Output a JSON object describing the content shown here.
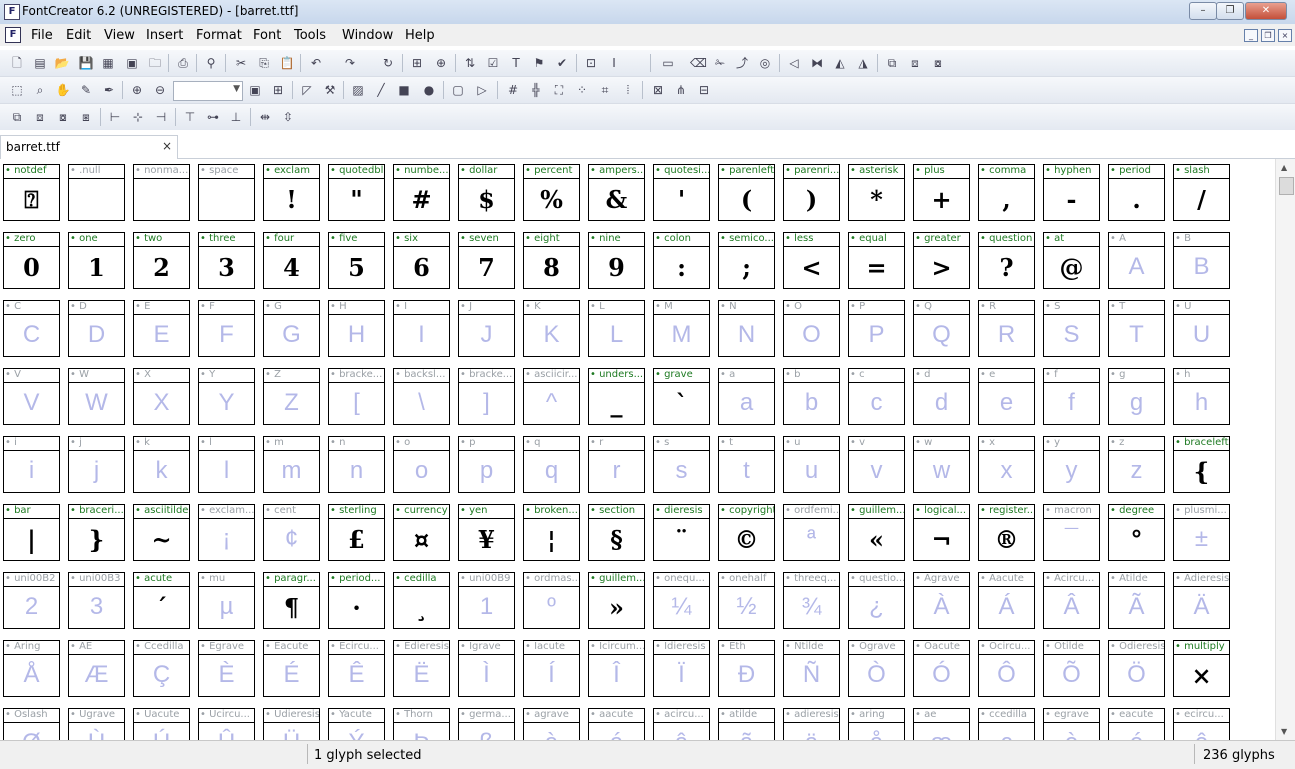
{
  "window": {
    "title": "FontCreator 6.2 (UNREGISTERED) - [barret.ttf]"
  },
  "menu": [
    "File",
    "Edit",
    "View",
    "Insert",
    "Format",
    "Font",
    "Tools",
    "Window",
    "Help"
  ],
  "toolbar": {
    "zoom_value": ""
  },
  "tab": {
    "label": "barret.ttf",
    "close": "×"
  },
  "status": {
    "selection": "1 glyph selected",
    "count": "236 glyphs"
  },
  "glyphs": [
    {
      "name": "notdef",
      "char": "⍰",
      "defined": true
    },
    {
      "name": ".null",
      "char": "",
      "defined": false
    },
    {
      "name": "nonma...",
      "char": "",
      "defined": false
    },
    {
      "name": "space",
      "char": "",
      "defined": false
    },
    {
      "name": "exclam",
      "char": "!",
      "defined": true
    },
    {
      "name": "quotedbl",
      "char": "\"",
      "defined": true
    },
    {
      "name": "numbe...",
      "char": "#",
      "defined": true
    },
    {
      "name": "dollar",
      "char": "$",
      "defined": true
    },
    {
      "name": "percent",
      "char": "%",
      "defined": true
    },
    {
      "name": "ampers...",
      "char": "&",
      "defined": true
    },
    {
      "name": "quotesi...",
      "char": "'",
      "defined": true
    },
    {
      "name": "parenleft",
      "char": "(",
      "defined": true
    },
    {
      "name": "parenri...",
      "char": ")",
      "defined": true
    },
    {
      "name": "asterisk",
      "char": "*",
      "defined": true
    },
    {
      "name": "plus",
      "char": "+",
      "defined": true
    },
    {
      "name": "comma",
      "char": ",",
      "defined": true
    },
    {
      "name": "hyphen",
      "char": "-",
      "defined": true
    },
    {
      "name": "period",
      "char": ".",
      "defined": true
    },
    {
      "name": "slash",
      "char": "/",
      "defined": true
    },
    {
      "name": "zero",
      "char": "0",
      "defined": true
    },
    {
      "name": "one",
      "char": "1",
      "defined": true
    },
    {
      "name": "two",
      "char": "2",
      "defined": true
    },
    {
      "name": "three",
      "char": "3",
      "defined": true
    },
    {
      "name": "four",
      "char": "4",
      "defined": true
    },
    {
      "name": "five",
      "char": "5",
      "defined": true
    },
    {
      "name": "six",
      "char": "6",
      "defined": true
    },
    {
      "name": "seven",
      "char": "7",
      "defined": true
    },
    {
      "name": "eight",
      "char": "8",
      "defined": true
    },
    {
      "name": "nine",
      "char": "9",
      "defined": true
    },
    {
      "name": "colon",
      "char": ":",
      "defined": true
    },
    {
      "name": "semico...",
      "char": ";",
      "defined": true
    },
    {
      "name": "less",
      "char": "<",
      "defined": true
    },
    {
      "name": "equal",
      "char": "=",
      "defined": true
    },
    {
      "name": "greater",
      "char": ">",
      "defined": true
    },
    {
      "name": "question",
      "char": "?",
      "defined": true
    },
    {
      "name": "at",
      "char": "@",
      "defined": true
    },
    {
      "name": "A",
      "char": "A",
      "defined": false
    },
    {
      "name": "B",
      "char": "B",
      "defined": false
    },
    {
      "name": "C",
      "char": "C",
      "defined": false
    },
    {
      "name": "D",
      "char": "D",
      "defined": false
    },
    {
      "name": "E",
      "char": "E",
      "defined": false
    },
    {
      "name": "F",
      "char": "F",
      "defined": false
    },
    {
      "name": "G",
      "char": "G",
      "defined": false
    },
    {
      "name": "H",
      "char": "H",
      "defined": false
    },
    {
      "name": "I",
      "char": "I",
      "defined": false
    },
    {
      "name": "J",
      "char": "J",
      "defined": false
    },
    {
      "name": "K",
      "char": "K",
      "defined": false
    },
    {
      "name": "L",
      "char": "L",
      "defined": false
    },
    {
      "name": "M",
      "char": "M",
      "defined": false
    },
    {
      "name": "N",
      "char": "N",
      "defined": false
    },
    {
      "name": "O",
      "char": "O",
      "defined": false
    },
    {
      "name": "P",
      "char": "P",
      "defined": false
    },
    {
      "name": "Q",
      "char": "Q",
      "defined": false
    },
    {
      "name": "R",
      "char": "R",
      "defined": false
    },
    {
      "name": "S",
      "char": "S",
      "defined": false
    },
    {
      "name": "T",
      "char": "T",
      "defined": false
    },
    {
      "name": "U",
      "char": "U",
      "defined": false
    },
    {
      "name": "V",
      "char": "V",
      "defined": false
    },
    {
      "name": "W",
      "char": "W",
      "defined": false
    },
    {
      "name": "X",
      "char": "X",
      "defined": false
    },
    {
      "name": "Y",
      "char": "Y",
      "defined": false
    },
    {
      "name": "Z",
      "char": "Z",
      "defined": false
    },
    {
      "name": "bracke...",
      "char": "[",
      "defined": false
    },
    {
      "name": "backsl...",
      "char": "\\",
      "defined": false
    },
    {
      "name": "bracke...",
      "char": "]",
      "defined": false
    },
    {
      "name": "asciicir...",
      "char": "^",
      "defined": false
    },
    {
      "name": "unders...",
      "char": "_",
      "defined": true
    },
    {
      "name": "grave",
      "char": "`",
      "defined": true
    },
    {
      "name": "a",
      "char": "a",
      "defined": false
    },
    {
      "name": "b",
      "char": "b",
      "defined": false
    },
    {
      "name": "c",
      "char": "c",
      "defined": false
    },
    {
      "name": "d",
      "char": "d",
      "defined": false
    },
    {
      "name": "e",
      "char": "e",
      "defined": false
    },
    {
      "name": "f",
      "char": "f",
      "defined": false
    },
    {
      "name": "g",
      "char": "g",
      "defined": false
    },
    {
      "name": "h",
      "char": "h",
      "defined": false
    },
    {
      "name": "i",
      "char": "i",
      "defined": false
    },
    {
      "name": "j",
      "char": "j",
      "defined": false
    },
    {
      "name": "k",
      "char": "k",
      "defined": false
    },
    {
      "name": "l",
      "char": "l",
      "defined": false
    },
    {
      "name": "m",
      "char": "m",
      "defined": false
    },
    {
      "name": "n",
      "char": "n",
      "defined": false
    },
    {
      "name": "o",
      "char": "o",
      "defined": false
    },
    {
      "name": "p",
      "char": "p",
      "defined": false
    },
    {
      "name": "q",
      "char": "q",
      "defined": false
    },
    {
      "name": "r",
      "char": "r",
      "defined": false
    },
    {
      "name": "s",
      "char": "s",
      "defined": false
    },
    {
      "name": "t",
      "char": "t",
      "defined": false
    },
    {
      "name": "u",
      "char": "u",
      "defined": false
    },
    {
      "name": "v",
      "char": "v",
      "defined": false
    },
    {
      "name": "w",
      "char": "w",
      "defined": false
    },
    {
      "name": "x",
      "char": "x",
      "defined": false
    },
    {
      "name": "y",
      "char": "y",
      "defined": false
    },
    {
      "name": "z",
      "char": "z",
      "defined": false
    },
    {
      "name": "braceleft",
      "char": "{",
      "defined": true
    },
    {
      "name": "bar",
      "char": "|",
      "defined": true
    },
    {
      "name": "braceri...",
      "char": "}",
      "defined": true
    },
    {
      "name": "asciitilde",
      "char": "~",
      "defined": true
    },
    {
      "name": "exclam...",
      "char": "¡",
      "defined": false
    },
    {
      "name": "cent",
      "char": "¢",
      "defined": false
    },
    {
      "name": "sterling",
      "char": "£",
      "defined": true
    },
    {
      "name": "currency",
      "char": "¤",
      "defined": true
    },
    {
      "name": "yen",
      "char": "¥",
      "defined": true
    },
    {
      "name": "broken...",
      "char": "¦",
      "defined": true
    },
    {
      "name": "section",
      "char": "§",
      "defined": true
    },
    {
      "name": "dieresis",
      "char": "¨",
      "defined": true
    },
    {
      "name": "copyright",
      "char": "©",
      "defined": true
    },
    {
      "name": "ordfemi...",
      "char": "ª",
      "defined": false
    },
    {
      "name": "guillem...",
      "char": "«",
      "defined": true
    },
    {
      "name": "logical...",
      "char": "¬",
      "defined": true
    },
    {
      "name": "register...",
      "char": "®",
      "defined": true
    },
    {
      "name": "macron",
      "char": "¯",
      "defined": false
    },
    {
      "name": "degree",
      "char": "°",
      "defined": true
    },
    {
      "name": "plusmi...",
      "char": "±",
      "defined": false
    },
    {
      "name": "uni00B2",
      "char": "2",
      "defined": false
    },
    {
      "name": "uni00B3",
      "char": "3",
      "defined": false
    },
    {
      "name": "acute",
      "char": "´",
      "defined": true
    },
    {
      "name": "mu",
      "char": "µ",
      "defined": false
    },
    {
      "name": "paragr...",
      "char": "¶",
      "defined": true
    },
    {
      "name": "period...",
      "char": "·",
      "defined": true
    },
    {
      "name": "cedilla",
      "char": "¸",
      "defined": true
    },
    {
      "name": "uni00B9",
      "char": "1",
      "defined": false
    },
    {
      "name": "ordmas...",
      "char": "º",
      "defined": false
    },
    {
      "name": "guillem...",
      "char": "»",
      "defined": true
    },
    {
      "name": "onequ...",
      "char": "¼",
      "defined": false
    },
    {
      "name": "onehalf",
      "char": "½",
      "defined": false
    },
    {
      "name": "threeq...",
      "char": "¾",
      "defined": false
    },
    {
      "name": "questio...",
      "char": "¿",
      "defined": false
    },
    {
      "name": "Agrave",
      "char": "À",
      "defined": false
    },
    {
      "name": "Aacute",
      "char": "Á",
      "defined": false
    },
    {
      "name": "Acircu...",
      "char": "Â",
      "defined": false
    },
    {
      "name": "Atilde",
      "char": "Ã",
      "defined": false
    },
    {
      "name": "Adieresis",
      "char": "Ä",
      "defined": false
    },
    {
      "name": "Aring",
      "char": "Å",
      "defined": false
    },
    {
      "name": "AE",
      "char": "Æ",
      "defined": false
    },
    {
      "name": "Ccedilla",
      "char": "Ç",
      "defined": false
    },
    {
      "name": "Egrave",
      "char": "È",
      "defined": false
    },
    {
      "name": "Eacute",
      "char": "É",
      "defined": false
    },
    {
      "name": "Ecircu...",
      "char": "Ê",
      "defined": false
    },
    {
      "name": "Edieresis",
      "char": "Ë",
      "defined": false
    },
    {
      "name": "Igrave",
      "char": "Ì",
      "defined": false
    },
    {
      "name": "Iacute",
      "char": "Í",
      "defined": false
    },
    {
      "name": "Icircum...",
      "char": "Î",
      "defined": false
    },
    {
      "name": "Idieresis",
      "char": "Ï",
      "defined": false
    },
    {
      "name": "Eth",
      "char": "Ð",
      "defined": false
    },
    {
      "name": "Ntilde",
      "char": "Ñ",
      "defined": false
    },
    {
      "name": "Ograve",
      "char": "Ò",
      "defined": false
    },
    {
      "name": "Oacute",
      "char": "Ó",
      "defined": false
    },
    {
      "name": "Ocircu...",
      "char": "Ô",
      "defined": false
    },
    {
      "name": "Otilde",
      "char": "Õ",
      "defined": false
    },
    {
      "name": "Odieresis",
      "char": "Ö",
      "defined": false
    },
    {
      "name": "multiply",
      "char": "×",
      "defined": true
    },
    {
      "name": "Oslash",
      "char": "Ø",
      "defined": false
    },
    {
      "name": "Ugrave",
      "char": "Ù",
      "defined": false
    },
    {
      "name": "Uacute",
      "char": "Ú",
      "defined": false
    },
    {
      "name": "Ucircu...",
      "char": "Û",
      "defined": false
    },
    {
      "name": "Udieresis",
      "char": "Ü",
      "defined": false
    },
    {
      "name": "Yacute",
      "char": "Ý",
      "defined": false
    },
    {
      "name": "Thorn",
      "char": "Þ",
      "defined": false
    },
    {
      "name": "germa...",
      "char": "ß",
      "defined": false
    },
    {
      "name": "agrave",
      "char": "à",
      "defined": false
    },
    {
      "name": "aacute",
      "char": "á",
      "defined": false
    },
    {
      "name": "acircu...",
      "char": "â",
      "defined": false
    },
    {
      "name": "atilde",
      "char": "ã",
      "defined": false
    },
    {
      "name": "adieresis",
      "char": "ä",
      "defined": false
    },
    {
      "name": "aring",
      "char": "å",
      "defined": false
    },
    {
      "name": "ae",
      "char": "æ",
      "defined": false
    },
    {
      "name": "ccedilla",
      "char": "ç",
      "defined": false
    },
    {
      "name": "egrave",
      "char": "è",
      "defined": false
    },
    {
      "name": "eacute",
      "char": "é",
      "defined": false
    },
    {
      "name": "ecircu...",
      "char": "ê",
      "defined": false
    }
  ]
}
